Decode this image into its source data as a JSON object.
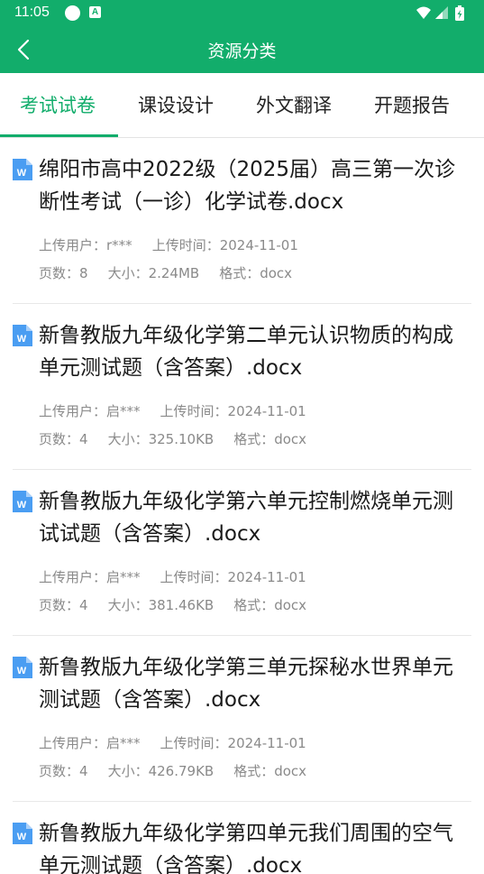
{
  "status_bar": {
    "time": "11:05",
    "a_badge": "A"
  },
  "app_bar": {
    "title": "资源分类"
  },
  "tabs": [
    {
      "label": "考试试卷",
      "active": true
    },
    {
      "label": "课设设计",
      "active": false
    },
    {
      "label": "外文翻译",
      "active": false
    },
    {
      "label": "开题报告",
      "active": false
    }
  ],
  "labels": {
    "uploader": "上传用户：",
    "upload_time": "上传时间：",
    "pages": "页数：",
    "size": "大小：",
    "format": "格式："
  },
  "icon_letter": "W",
  "colors": {
    "brand": "#12ad6b",
    "doc_icon": "#4a9df2",
    "meta_text": "#8a8a8a"
  },
  "items": [
    {
      "title": "绵阳市高中2022级（2025届）高三第一次诊断性考试（一诊）化学试卷.docx",
      "uploader": "r***",
      "upload_time": "2024-11-01",
      "pages": "8",
      "size": "2.24MB",
      "format": "docx"
    },
    {
      "title": "新鲁教版九年级化学第二单元认识物质的构成单元测试题（含答案）.docx",
      "uploader": "启***",
      "upload_time": "2024-11-01",
      "pages": "4",
      "size": "325.10KB",
      "format": "docx"
    },
    {
      "title": "新鲁教版九年级化学第六单元控制燃烧单元测试试题（含答案）.docx",
      "uploader": "启***",
      "upload_time": "2024-11-01",
      "pages": "4",
      "size": "381.46KB",
      "format": "docx"
    },
    {
      "title": "新鲁教版九年级化学第三单元探秘水世界单元测试题（含答案）.docx",
      "uploader": "启***",
      "upload_time": "2024-11-01",
      "pages": "4",
      "size": "426.79KB",
      "format": "docx"
    },
    {
      "title": "新鲁教版九年级化学第四单元我们周围的空气单元测试题（含答案）.docx"
    }
  ]
}
